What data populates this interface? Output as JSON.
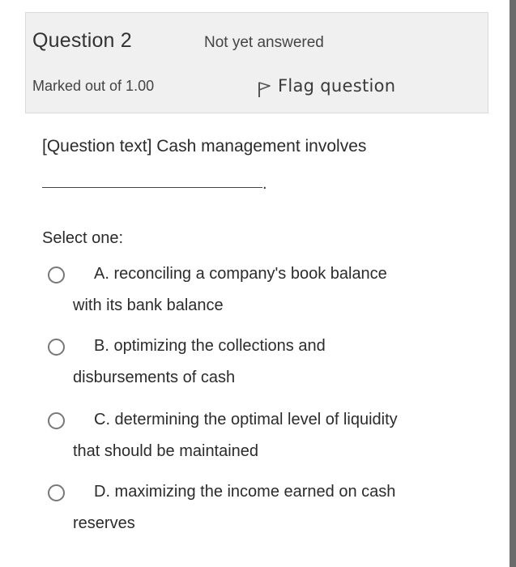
{
  "question": {
    "title": "Question 2",
    "state": "Not yet answered",
    "grade": "Marked out of 1.00",
    "flag_label": "Flag question",
    "flag_icon": "flag-icon"
  },
  "question_text": "[Question text] Cash management involves",
  "blank_suffix": ".",
  "answer_prompt": "Select one:",
  "options": [
    {
      "line1": "A. reconciling a company's book balance",
      "line2": "with its bank balance"
    },
    {
      "line1": "B. optimizing the collections and",
      "line2": "disbursements of cash"
    },
    {
      "line1": "C. determining the optimal level of liquidity",
      "line2": "that should be maintained"
    },
    {
      "line1": "D. maximizing the income earned on cash",
      "line2": "reserves"
    }
  ]
}
